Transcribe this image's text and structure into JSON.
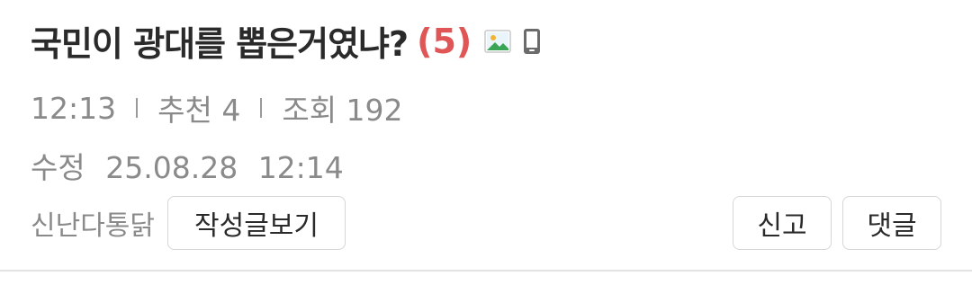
{
  "post": {
    "title": "국민이 광대를 뽑은거였냐?",
    "comment_count": "(5)",
    "icons": [
      "image-icon",
      "mobile-icon"
    ],
    "time": "12:13",
    "recommend_label": "추천 4",
    "views_label": "조회 192",
    "edited_label": "수정",
    "edited_date": "25.08.28",
    "edited_time": "12:14",
    "author": "신난다통닭"
  },
  "actions": {
    "view_posts": "작성글보기",
    "report": "신고",
    "comment": "댓글"
  },
  "colors": {
    "title": "#2a2a2a",
    "comment_count": "#e05555",
    "meta": "#8a8a8a",
    "border": "#d6d6d6"
  }
}
